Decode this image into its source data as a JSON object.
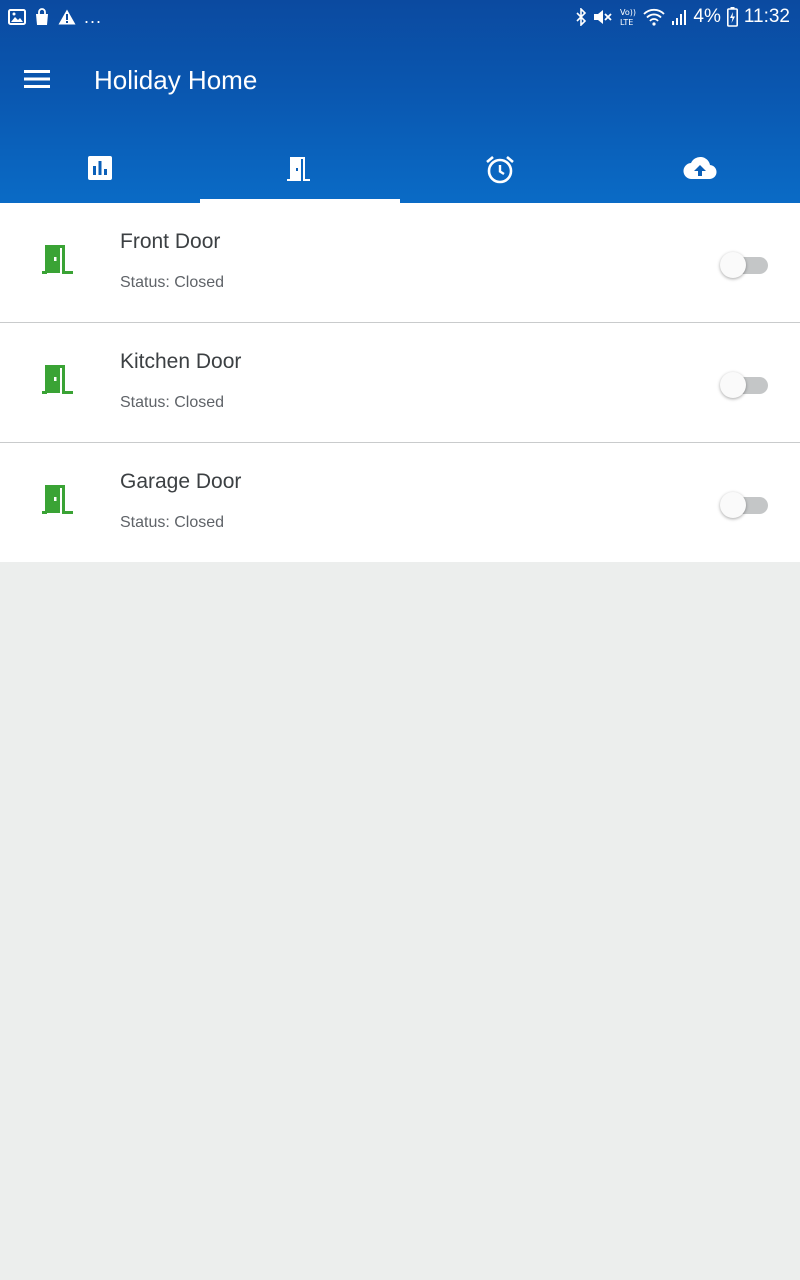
{
  "status_bar": {
    "left_icons": [
      "image-icon",
      "shopping-bag-icon",
      "warning-icon"
    ],
    "overflow": "...",
    "right_icons": [
      "bluetooth-icon",
      "mute-icon",
      "volte-icon",
      "wifi-icon",
      "signal-icon"
    ],
    "volte_label": "Vo)) LTE",
    "battery": "4%",
    "time": "11:32"
  },
  "toolbar": {
    "title": "Holiday Home"
  },
  "tabs": [
    {
      "icon": "bar-chart-icon",
      "active": false
    },
    {
      "icon": "door-icon",
      "active": true
    },
    {
      "icon": "alarm-clock-icon",
      "active": false
    },
    {
      "icon": "cloud-upload-icon",
      "active": false
    }
  ],
  "doors": [
    {
      "name": "Front Door",
      "status": "Status: Closed",
      "enabled": false
    },
    {
      "name": "Kitchen Door",
      "status": "Status: Closed",
      "enabled": false
    },
    {
      "name": "Garage Door",
      "status": "Status: Closed",
      "enabled": false
    }
  ],
  "colors": {
    "app_bar": "#0a57b0",
    "door_icon": "#3aa335",
    "switch_track_off": "#c4c6c7",
    "background": "#eceeed"
  }
}
